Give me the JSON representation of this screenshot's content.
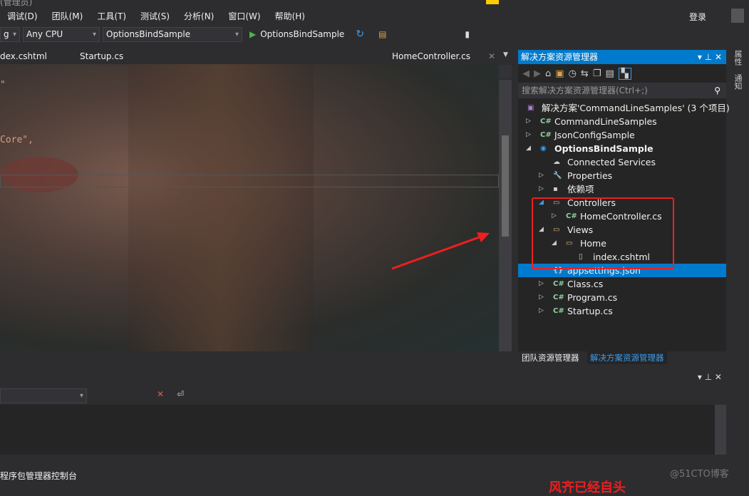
{
  "title_partial": "(管理员)",
  "menu": [
    "调试(D)",
    "团队(M)",
    "工具(T)",
    "测试(S)",
    "分析(N)",
    "窗口(W)",
    "帮助(H)"
  ],
  "login": "登录",
  "toolbar": {
    "config": "g",
    "platform": "Any CPU",
    "project": "OptionsBindSample",
    "run": "OptionsBindSample"
  },
  "tabs": {
    "left1": "dex.cshtml",
    "left2": "Startup.cs",
    "right": "HomeController.cs"
  },
  "code": {
    "line1": "\"",
    "line2": "Core\","
  },
  "side_tabs": [
    "属性",
    "通知"
  ],
  "solution_explorer": {
    "title": "解决方案资源管理器",
    "search_placeholder": "搜索解决方案资源管理器(Ctrl+;)",
    "items": [
      {
        "label": "解决方案'CommandLineSamples' (3 个项目)",
        "icon": "solution-icon",
        "level": 0,
        "expand": ""
      },
      {
        "label": "CommandLineSamples",
        "icon": "csharp-project-icon",
        "level": 1,
        "expand": "collapsed"
      },
      {
        "label": "JsonConfigSample",
        "icon": "csharp-project-icon",
        "level": 1,
        "expand": "collapsed"
      },
      {
        "label": "OptionsBindSample",
        "icon": "web-project-icon",
        "level": 1,
        "expand": "expanded",
        "bold": true
      },
      {
        "label": "Connected Services",
        "icon": "cloud-icon",
        "level": 2,
        "expand": ""
      },
      {
        "label": "Properties",
        "icon": "wrench-icon",
        "level": 2,
        "expand": "collapsed"
      },
      {
        "label": "依赖项",
        "icon": "dependencies-icon",
        "level": 2,
        "expand": "collapsed"
      },
      {
        "label": "Controllers",
        "icon": "folder-icon",
        "level": 2,
        "expand": "expanded"
      },
      {
        "label": "HomeController.cs",
        "icon": "csharp-file-icon",
        "level": 3,
        "expand": "collapsed"
      },
      {
        "label": "Views",
        "icon": "folder-icon",
        "level": 2,
        "expand": "expanded"
      },
      {
        "label": "Home",
        "icon": "folder-icon",
        "level": 3,
        "expand": "expanded"
      },
      {
        "label": "index.cshtml",
        "icon": "razor-file-icon",
        "level": 4,
        "expand": ""
      },
      {
        "label": "appsettings.json",
        "icon": "json-file-icon",
        "level": 2,
        "expand": "",
        "selected": true
      },
      {
        "label": "Class.cs",
        "icon": "csharp-file-icon",
        "level": 2,
        "expand": "collapsed"
      },
      {
        "label": "Program.cs",
        "icon": "csharp-file-icon",
        "level": 2,
        "expand": "collapsed"
      },
      {
        "label": "Startup.cs",
        "icon": "csharp-file-icon",
        "level": 2,
        "expand": "collapsed"
      }
    ],
    "bottom_tabs": [
      "团队资源管理器",
      "解决方案资源管理器"
    ]
  },
  "status": {
    "console": "程序包管理器控制台",
    "watermark": "@51CTO博客",
    "caption_partial": "风齐已经自头"
  },
  "colors": {
    "accent": "#007acc",
    "highlight": "#f01e1e"
  }
}
